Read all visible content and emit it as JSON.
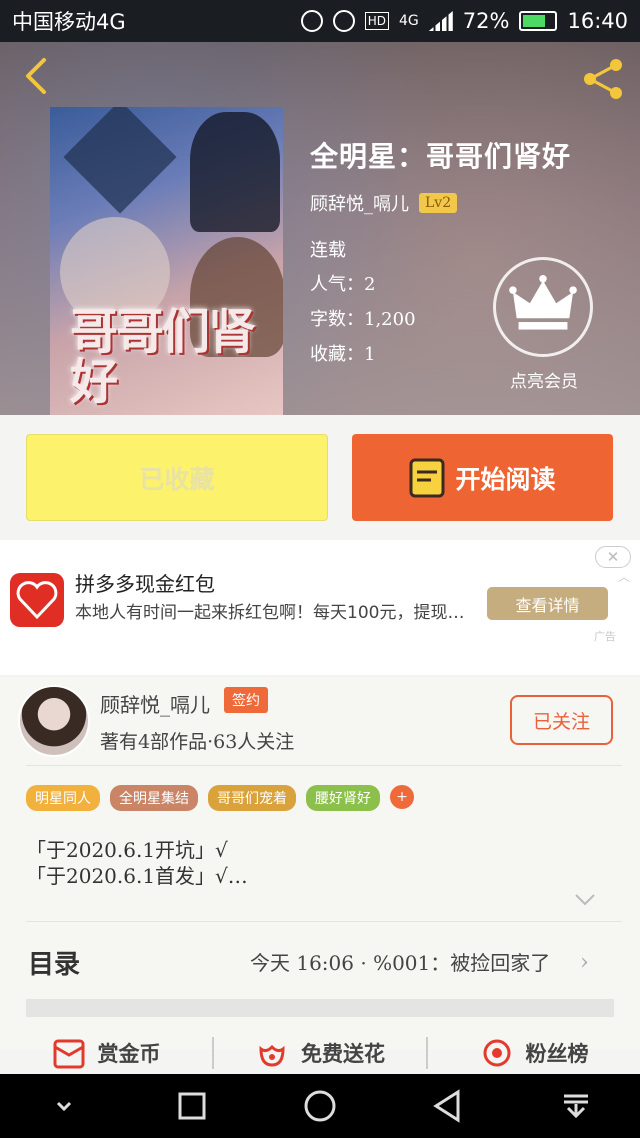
{
  "status_bar": {
    "carrier": "中国移动4G",
    "hd": "HD",
    "network": "4G",
    "battery": "72%",
    "time": "16:40"
  },
  "book": {
    "title": "全明星：哥哥们肾好",
    "cover_title": "哥哥们肾好",
    "author": "顾辞悦_嗝儿",
    "level": "Lv2",
    "status": "连载",
    "popularity": "人气：2",
    "words": "字数：1,200",
    "favorites": "收藏：1",
    "vip_label": "点亮会员"
  },
  "actions": {
    "favorited": "已收藏",
    "start_reading": "开始阅读"
  },
  "ad": {
    "title": "拼多多现金红包",
    "desc": "本地人有时间一起来拆红包啊！每天100元，提现…",
    "button": "查看详情",
    "close": "✕",
    "tag": "广告"
  },
  "author_profile": {
    "name": "顾辞悦_嗝儿",
    "badge": "签约",
    "stats": "著有4部作品·63人关注",
    "follow": "已关注"
  },
  "tags": [
    {
      "label": "明星同人",
      "color": "#f2b13c"
    },
    {
      "label": "全明星集结",
      "color": "#c98566"
    },
    {
      "label": "哥哥们宠着",
      "color": "#d9a23a"
    },
    {
      "label": "腰好肾好",
      "color": "#8cc04b"
    },
    {
      "label": "+",
      "color": "#ee6a3a"
    }
  ],
  "intro": {
    "line1": "「于2020.6.1开坑」√",
    "line2": "「于2020.6.1首发」√…"
  },
  "toc": {
    "label": "目录",
    "latest": "今天 16:06 · %001：被捡回家了"
  },
  "bottom_actions": [
    {
      "label": "赏金币",
      "icon": "red-envelope-icon"
    },
    {
      "label": "免费送花",
      "icon": "flower-icon"
    },
    {
      "label": "粉丝榜",
      "icon": "medal-icon"
    }
  ]
}
